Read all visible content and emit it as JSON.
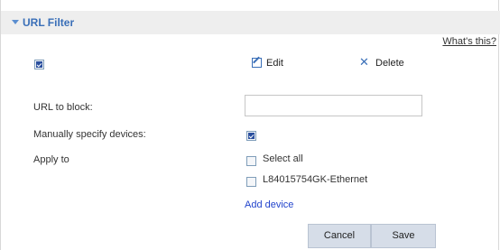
{
  "header": {
    "title": "URL Filter"
  },
  "help": {
    "label": "What's this?"
  },
  "toolbar": {
    "edit_label": "Edit",
    "delete_label": "Delete",
    "enable_checked": true
  },
  "form": {
    "url_label": "URL to block:",
    "url_value": "",
    "manual_label": "Manually specify devices:",
    "manual_checked": true,
    "apply_label": "Apply to",
    "options": [
      {
        "label": "Select all",
        "checked": false
      },
      {
        "label": "L84015754GK-Ethernet",
        "checked": false
      }
    ],
    "add_device_label": "Add device"
  },
  "actions": {
    "cancel_label": "Cancel",
    "save_label": "Save"
  },
  "colors": {
    "accent": "#3a6fb8",
    "link": "#2244cc",
    "header_bg": "#eeeeee",
    "button_bg": "#d6dde8"
  }
}
